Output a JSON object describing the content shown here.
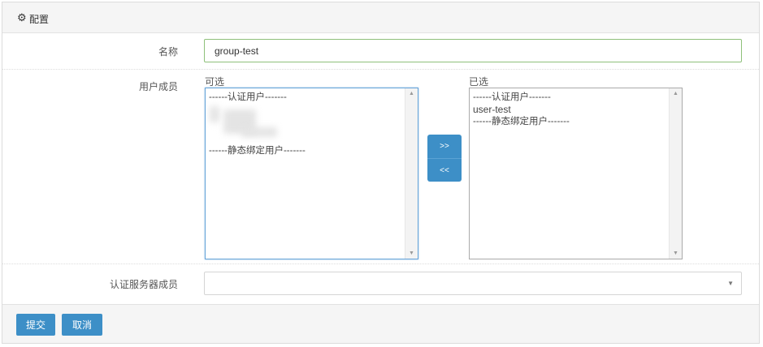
{
  "header": {
    "icon": "gear-icon",
    "title": "配置"
  },
  "form": {
    "name": {
      "label": "名称",
      "value": "group-test"
    },
    "members": {
      "label": "用户成员",
      "available": {
        "caption": "可选",
        "items": [
          "------认证用户-------",
          "------静态绑定用户-------"
        ]
      },
      "selected": {
        "caption": "已选",
        "items": [
          "------认证用户-------",
          "user-test",
          "------静态绑定用户-------"
        ]
      },
      "add_label": ">>",
      "remove_label": "<<"
    },
    "auth_servers": {
      "label": "认证服务器成员",
      "value": ""
    }
  },
  "footer": {
    "submit_label": "提交",
    "cancel_label": "取消"
  },
  "colors": {
    "accent": "#3d8fc7",
    "focus_border": "#8ec07a"
  }
}
